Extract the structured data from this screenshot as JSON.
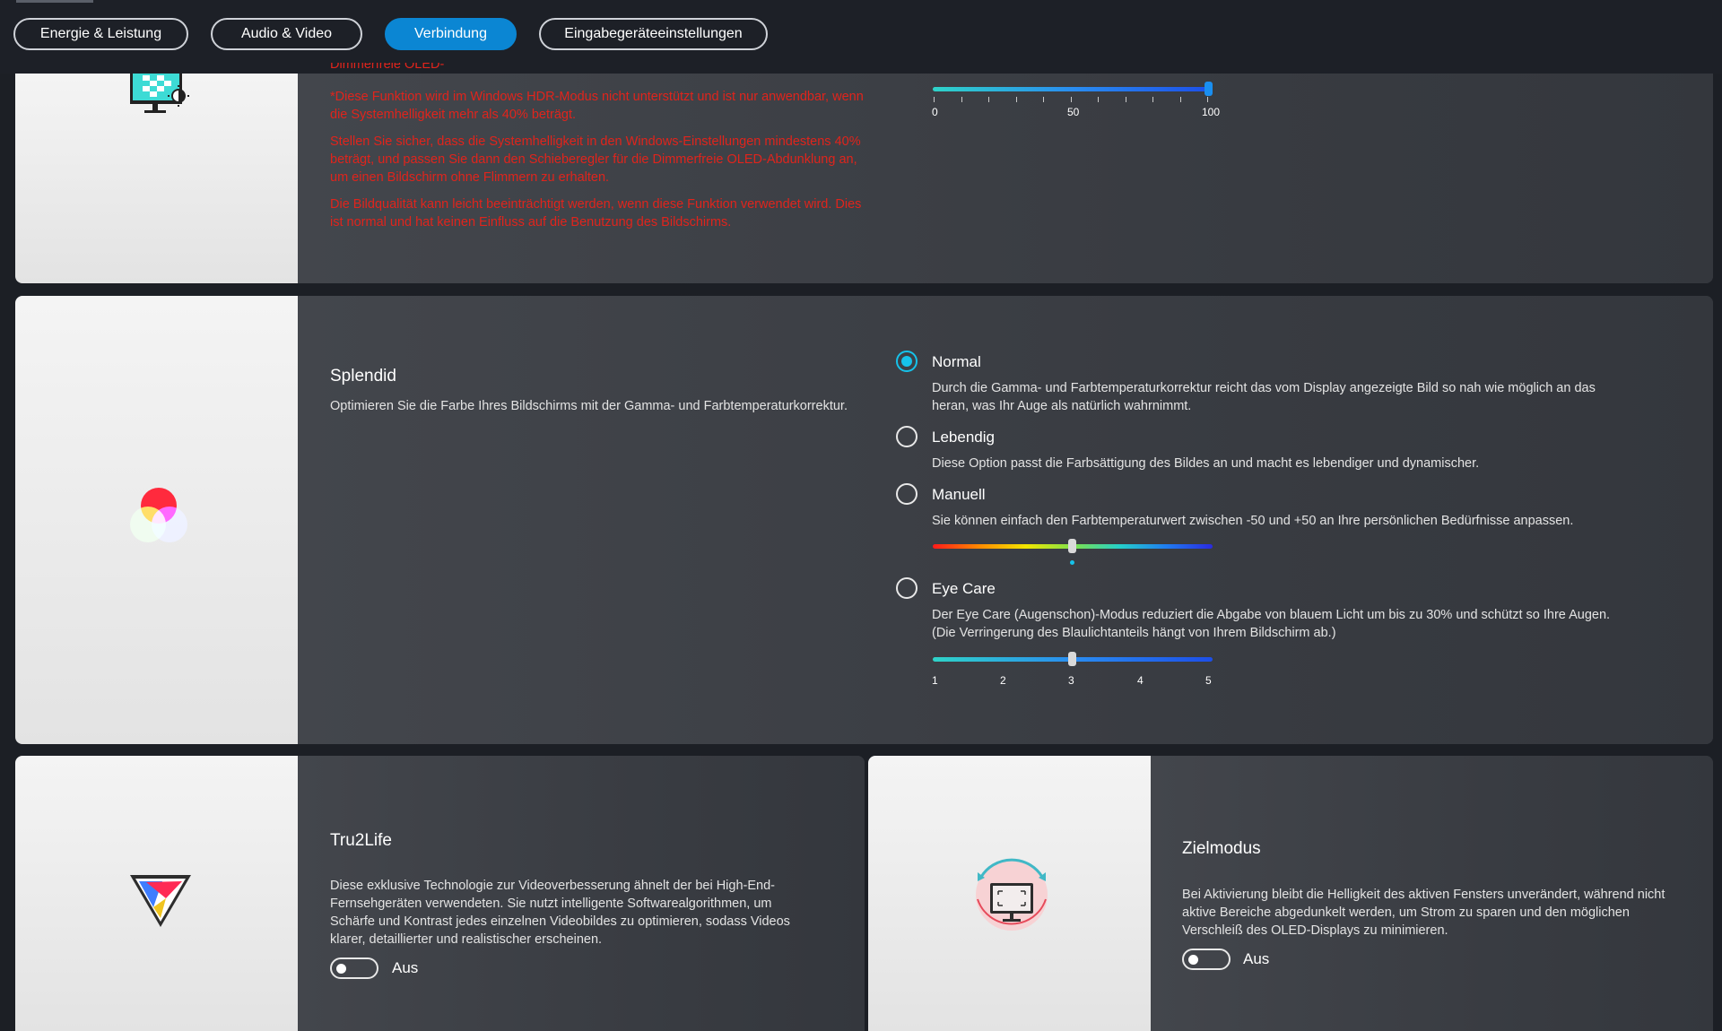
{
  "tabs": [
    {
      "label": "Energie & Leistung",
      "active": false
    },
    {
      "label": "Audio & Video",
      "active": false
    },
    {
      "label": "Verbindung",
      "active": true
    },
    {
      "label": "Eingabegeräteeinstellungen",
      "active": false
    }
  ],
  "oled_card": {
    "icon": "monitor-brightness-icon",
    "warnings": [
      "*Diese Funktion wird im Windows HDR-Modus nicht unterstützt und ist nur anwendbar, wenn die Systemhelligkeit mehr als 40% beträgt.",
      "Stellen Sie sicher, dass die Systemhelligkeit in den Windows-Einstellungen mindestens 40% beträgt, und passen Sie dann den Schieberegler für die Dimmerfreie OLED-Abdunklung an, um einen Bildschirm ohne Flimmern zu erhalten.",
      "Die Bildqualität kann leicht beeinträchtigt werden, wenn diese Funktion verwendet wird. Dies ist normal und hat keinen Einfluss auf die Benutzung des Bildschirms."
    ],
    "slider": {
      "min_label": "0",
      "mid_label": "50",
      "max_label": "100",
      "value": 100
    }
  },
  "splendid": {
    "icon": "rgb-color-circles-icon",
    "title": "Splendid",
    "description": "Optimieren Sie die Farbe Ihres Bildschirms mit der Gamma- und Farbtemperaturkorrektur.",
    "options": [
      {
        "label": "Normal",
        "checked": true,
        "desc": [
          "Durch die Gamma- und Farbtemperaturkorrektur reicht das vom Display angezeigte Bild so nah wie möglich an das",
          "heran, was Ihr Auge als natürlich wahrnimmt."
        ]
      },
      {
        "label": "Lebendig",
        "checked": false,
        "desc": [
          "Diese Option passt die Farbsättigung des Bildes an und macht es lebendiger und dynamischer."
        ]
      },
      {
        "label": "Manuell",
        "checked": false,
        "desc": [
          "Sie können einfach den Farbtemperaturwert zwischen -50 und +50 an Ihre persönlichen Bedürfnisse anpassen."
        ]
      },
      {
        "label": "Eye Care",
        "checked": false,
        "desc": [
          "Der Eye Care (Augenschon)-Modus reduziert die Abgabe von blauem Licht um bis zu 30% und schützt so Ihre Augen.",
          "(Die Verringerung des Blaulichtanteils hängt von Ihrem Bildschirm ab.)"
        ]
      }
    ],
    "manual_value": 0,
    "eyecare_slider": {
      "labels": [
        "1",
        "2",
        "3",
        "4",
        "5"
      ],
      "value": 3
    }
  },
  "tru2life": {
    "icon": "tru2life-triangle-icon",
    "title": "Tru2Life",
    "desc": [
      "Diese exklusive Technologie zur Videoverbesserung ähnelt der bei High-End-",
      "Fernsehgeräten verwendeten. Sie nutzt intelligente Softwarealgorithmen, um",
      "Schärfe und Kontrast jedes einzelnen Videobildes zu optimieren, sodass Videos",
      "klarer, detaillierter und realistischer erscheinen."
    ],
    "toggle_label": "Aus"
  },
  "zielmodus": {
    "icon": "target-mode-monitor-icon",
    "title": "Zielmodus",
    "desc": [
      "Bei Aktivierung bleibt die Helligkeit des aktiven Fensters unverändert, während nicht",
      "aktive Bereiche abgedunkelt werden, um Strom zu sparen und den möglichen",
      "Verschleiß des OLED-Displays zu minimieren."
    ],
    "toggle_label": "Aus"
  }
}
